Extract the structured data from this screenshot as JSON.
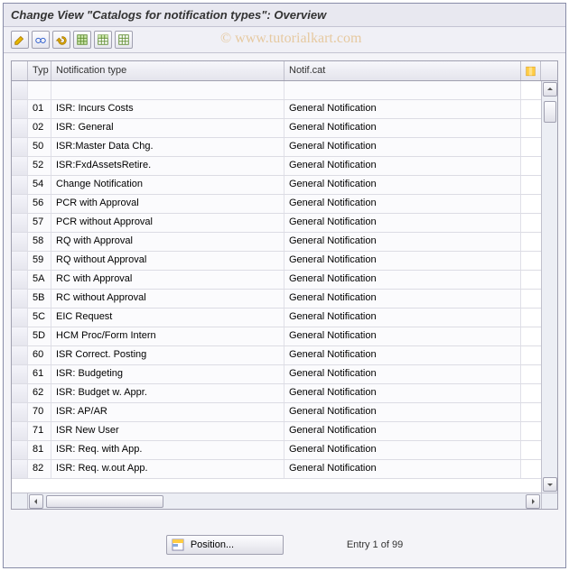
{
  "title": "Change View \"Catalogs for notification types\": Overview",
  "watermark": "© www.tutorialkart.com",
  "toolbar": [
    {
      "name": "other-view-icon"
    },
    {
      "name": "change-display-icon"
    },
    {
      "name": "undo-icon"
    },
    {
      "name": "select-all-icon"
    },
    {
      "name": "select-block-icon"
    },
    {
      "name": "deselect-all-icon"
    }
  ],
  "columns": {
    "typ": "Typ",
    "ntype": "Notification type",
    "ncat": "Notif.cat"
  },
  "rows": [
    {
      "typ": "",
      "ntype": "",
      "ncat": ""
    },
    {
      "typ": "01",
      "ntype": "ISR: Incurs Costs",
      "ncat": "General Notification"
    },
    {
      "typ": "02",
      "ntype": "ISR: General",
      "ncat": "General Notification"
    },
    {
      "typ": "50",
      "ntype": "ISR:Master Data Chg.",
      "ncat": "General Notification"
    },
    {
      "typ": "52",
      "ntype": "ISR:FxdAssetsRetire.",
      "ncat": "General Notification"
    },
    {
      "typ": "54",
      "ntype": "Change Notification",
      "ncat": "General Notification"
    },
    {
      "typ": "56",
      "ntype": "PCR with Approval",
      "ncat": "General Notification"
    },
    {
      "typ": "57",
      "ntype": "PCR without Approval",
      "ncat": "General Notification"
    },
    {
      "typ": "58",
      "ntype": "RQ with Approval",
      "ncat": "General Notification"
    },
    {
      "typ": "59",
      "ntype": "RQ without Approval",
      "ncat": "General Notification"
    },
    {
      "typ": "5A",
      "ntype": "RC with Approval",
      "ncat": "General Notification"
    },
    {
      "typ": "5B",
      "ntype": "RC without Approval",
      "ncat": "General Notification"
    },
    {
      "typ": "5C",
      "ntype": "EIC Request",
      "ncat": "General Notification"
    },
    {
      "typ": "5D",
      "ntype": "HCM Proc/Form Intern",
      "ncat": "General Notification"
    },
    {
      "typ": "60",
      "ntype": "ISR Correct. Posting",
      "ncat": "General Notification"
    },
    {
      "typ": "61",
      "ntype": "ISR: Budgeting",
      "ncat": "General Notification"
    },
    {
      "typ": "62",
      "ntype": "ISR: Budget w. Appr.",
      "ncat": "General Notification"
    },
    {
      "typ": "70",
      "ntype": "ISR: AP/AR",
      "ncat": "General Notification"
    },
    {
      "typ": "71",
      "ntype": "ISR New User",
      "ncat": "General Notification"
    },
    {
      "typ": "81",
      "ntype": "ISR: Req. with App.",
      "ncat": "General Notification"
    },
    {
      "typ": "82",
      "ntype": "ISR: Req. w.out App.",
      "ncat": "General Notification"
    }
  ],
  "footer": {
    "position_label": "Position...",
    "entry_text": "Entry 1 of 99"
  }
}
